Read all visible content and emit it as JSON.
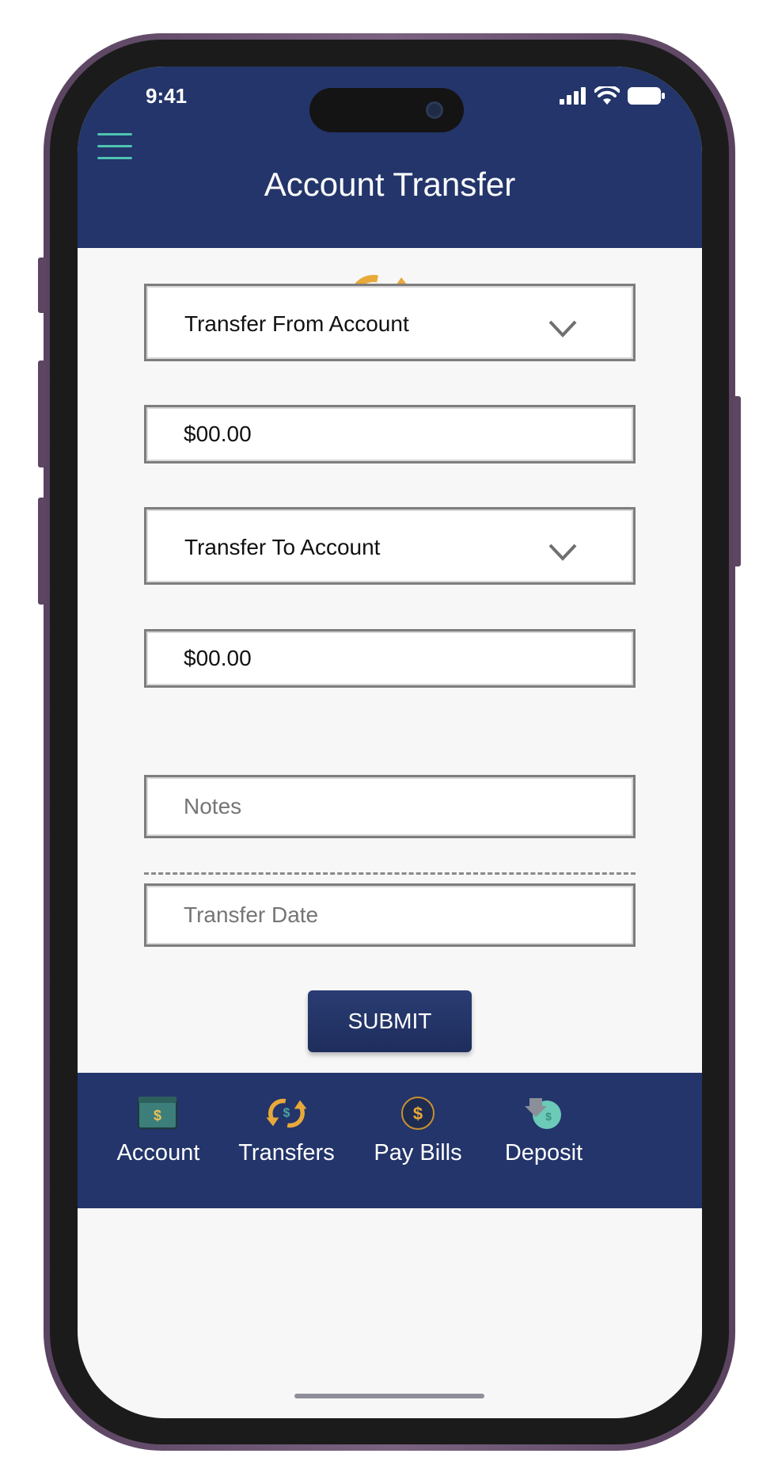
{
  "status_bar": {
    "time": "9:41"
  },
  "header": {
    "title": "Account Transfer"
  },
  "form": {
    "from_account": {
      "label": "Transfer From Account"
    },
    "from_amount": {
      "value": "$00.00"
    },
    "to_account": {
      "label": "Transfer To Account"
    },
    "to_amount": {
      "value": "$00.00"
    },
    "notes": {
      "placeholder": "Notes"
    },
    "transfer_date": {
      "placeholder": "Transfer Date"
    },
    "submit_label": "SUBMIT"
  },
  "tabbar": {
    "items": [
      {
        "label": "Account",
        "icon": "wallet-icon"
      },
      {
        "label": "Transfers",
        "icon": "transfer-icon"
      },
      {
        "label": "Pay Bills",
        "icon": "dollar-coin-icon"
      },
      {
        "label": "Deposit",
        "icon": "deposit-icon"
      }
    ]
  },
  "colors": {
    "header_bg": "#23356a",
    "accent_teal": "#4fc3b3",
    "accent_gold": "#e8a93a",
    "frame": "#6b5370"
  }
}
